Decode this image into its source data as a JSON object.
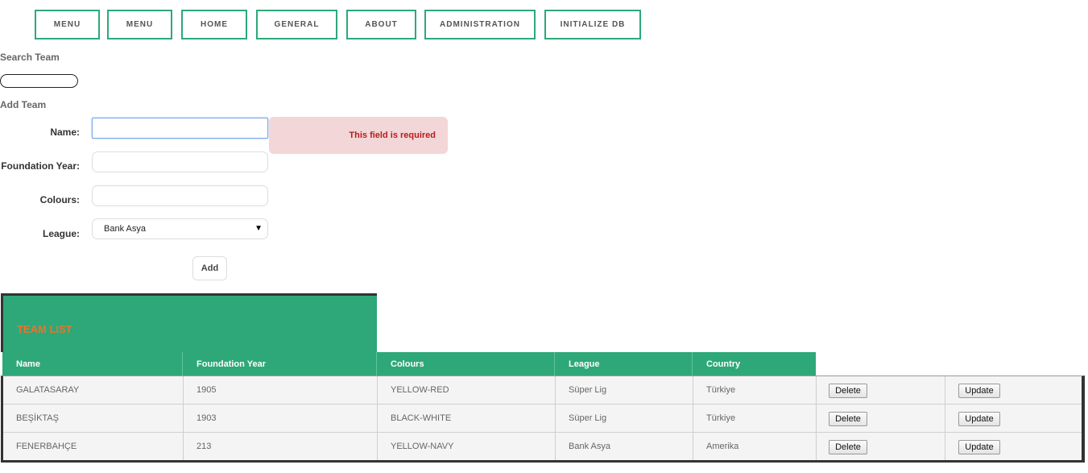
{
  "nav": {
    "items": [
      "MENU",
      "MENU",
      "HOME",
      "GENERAL",
      "ABOUT",
      "ADMINISTRATION",
      "INITIALIZE DB"
    ]
  },
  "search": {
    "heading": "Search Team",
    "value": ""
  },
  "add_form": {
    "heading": "Add Team",
    "name_label": "Name:",
    "year_label": "Foundation Year:",
    "colours_label": "Colours:",
    "league_label": "League:",
    "league_value": "Bank Asya",
    "error_message": "This field is required",
    "add_label": "Add"
  },
  "table": {
    "caption": "TEAM LIST",
    "headers": [
      "Name",
      "Foundation Year",
      "Colours",
      "League",
      "Country"
    ],
    "delete_label": "Delete",
    "update_label": "Update",
    "rows": [
      {
        "name": "GALATASARAY",
        "year": "1905",
        "colours": "YELLOW-RED",
        "league": "Süper Lig",
        "country": "Türkiye"
      },
      {
        "name": "BEŞİKTAŞ",
        "year": "1903",
        "colours": "BLACK-WHITE",
        "league": "Süper Lig",
        "country": "Türkiye"
      },
      {
        "name": "FENERBAHÇE",
        "year": "213",
        "colours": "YELLOW-NAVY",
        "league": "Bank Asya",
        "country": "Amerika"
      }
    ]
  },
  "colors": {
    "accent": "#2ea879",
    "error_bg": "#f3d6d7",
    "error_text": "#b71c1c",
    "caption_text": "#e8742c"
  }
}
